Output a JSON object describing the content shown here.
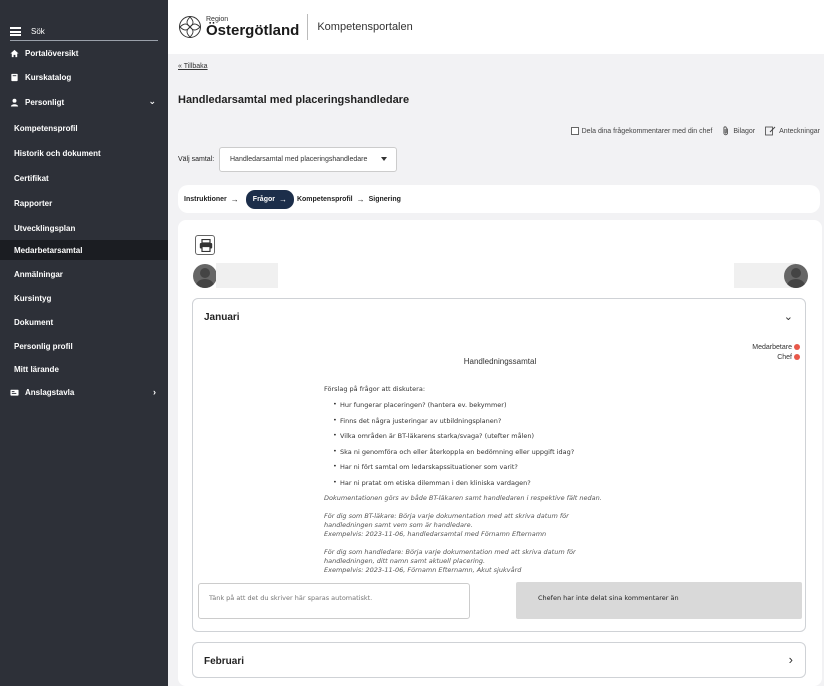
{
  "sidebar": {
    "search_placeholder": "Sök",
    "items": [
      {
        "label": "Portalöversikt"
      },
      {
        "label": "Kurskatalog"
      },
      {
        "label": "Personligt"
      },
      {
        "label": "Kompetensprofil"
      },
      {
        "label": "Historik och dokument"
      },
      {
        "label": "Certifikat"
      },
      {
        "label": "Rapporter"
      },
      {
        "label": "Utvecklingsplan"
      },
      {
        "label": "Medarbetarsamtal"
      },
      {
        "label": "Anmälningar"
      },
      {
        "label": "Kursintyg"
      },
      {
        "label": "Dokument"
      },
      {
        "label": "Personlig profil"
      },
      {
        "label": "Mitt lärande"
      },
      {
        "label": "Anslagstavla"
      }
    ]
  },
  "header": {
    "logo_region": "Region",
    "logo_name": "Östergötland",
    "portal_name": "Kompetensportalen"
  },
  "page": {
    "back_link": "« Tillbaka",
    "title": "Handledarsamtal med placeringshandledare",
    "share_label": "Dela dina frågekommentarer med din chef",
    "attachments_label": "Bilagor",
    "notes_label": "Anteckningar",
    "select_label": "Välj samtal:",
    "select_value": "Handledarsamtal med placeringshandledare"
  },
  "steps": [
    "Instruktioner",
    "Frågor",
    "Kompetensprofil",
    "Signering"
  ],
  "accordion_january": {
    "title": "Januari",
    "legend_employee": "Medarbetare",
    "legend_manager": "Chef",
    "form_title": "Handledningssamtal",
    "intro": "Förslag på frågor att diskutera:",
    "questions": [
      "Hur fungerar placeringen? (hantera ev. bekymmer)",
      "Finns det några justeringar av utbildningsplanen?",
      "Vilka områden är BT-läkarens starka/svaga? (utefter målen)",
      "Ska ni genomföra och eller återkoppla en bedömning eller uppgift idag?",
      "Har ni fört samtal om ledarskapssituationer som varit?",
      "Har ni pratat om etiska dilemman i den kliniska vardagen?"
    ],
    "doc_note": "Dokumentationen görs av både BT-läkaren samt handledaren i respektive fält nedan.",
    "bt_note_1": "För dig som BT-läkare: Börja varje dokumentation med att skriva datum för",
    "bt_note_2": "handledningen samt vem som är handledare.",
    "bt_note_3": "Exempelvis: 2023-11-06, handledarsamtal med Förnamn Efternamn",
    "sup_note_1": "För dig som handledare: Börja varje dokumentation med att skriva datum för",
    "sup_note_2": "handledningen, ditt namn samt aktuell placering.",
    "sup_note_3": "Exempelvis: 2023-11-06, Förnamn Efternamn, Akut sjukvård",
    "comment_placeholder": "Tänk på att det du skriver här sparas automatiskt.",
    "manager_status": "Chefen har inte delat sina kommentarer än"
  },
  "accordion_february": {
    "title": "Februari"
  },
  "colors": {
    "sidebar_bg": "#2d3038",
    "active_step": "#1c2e4a",
    "status_dot": "#e8584a"
  }
}
